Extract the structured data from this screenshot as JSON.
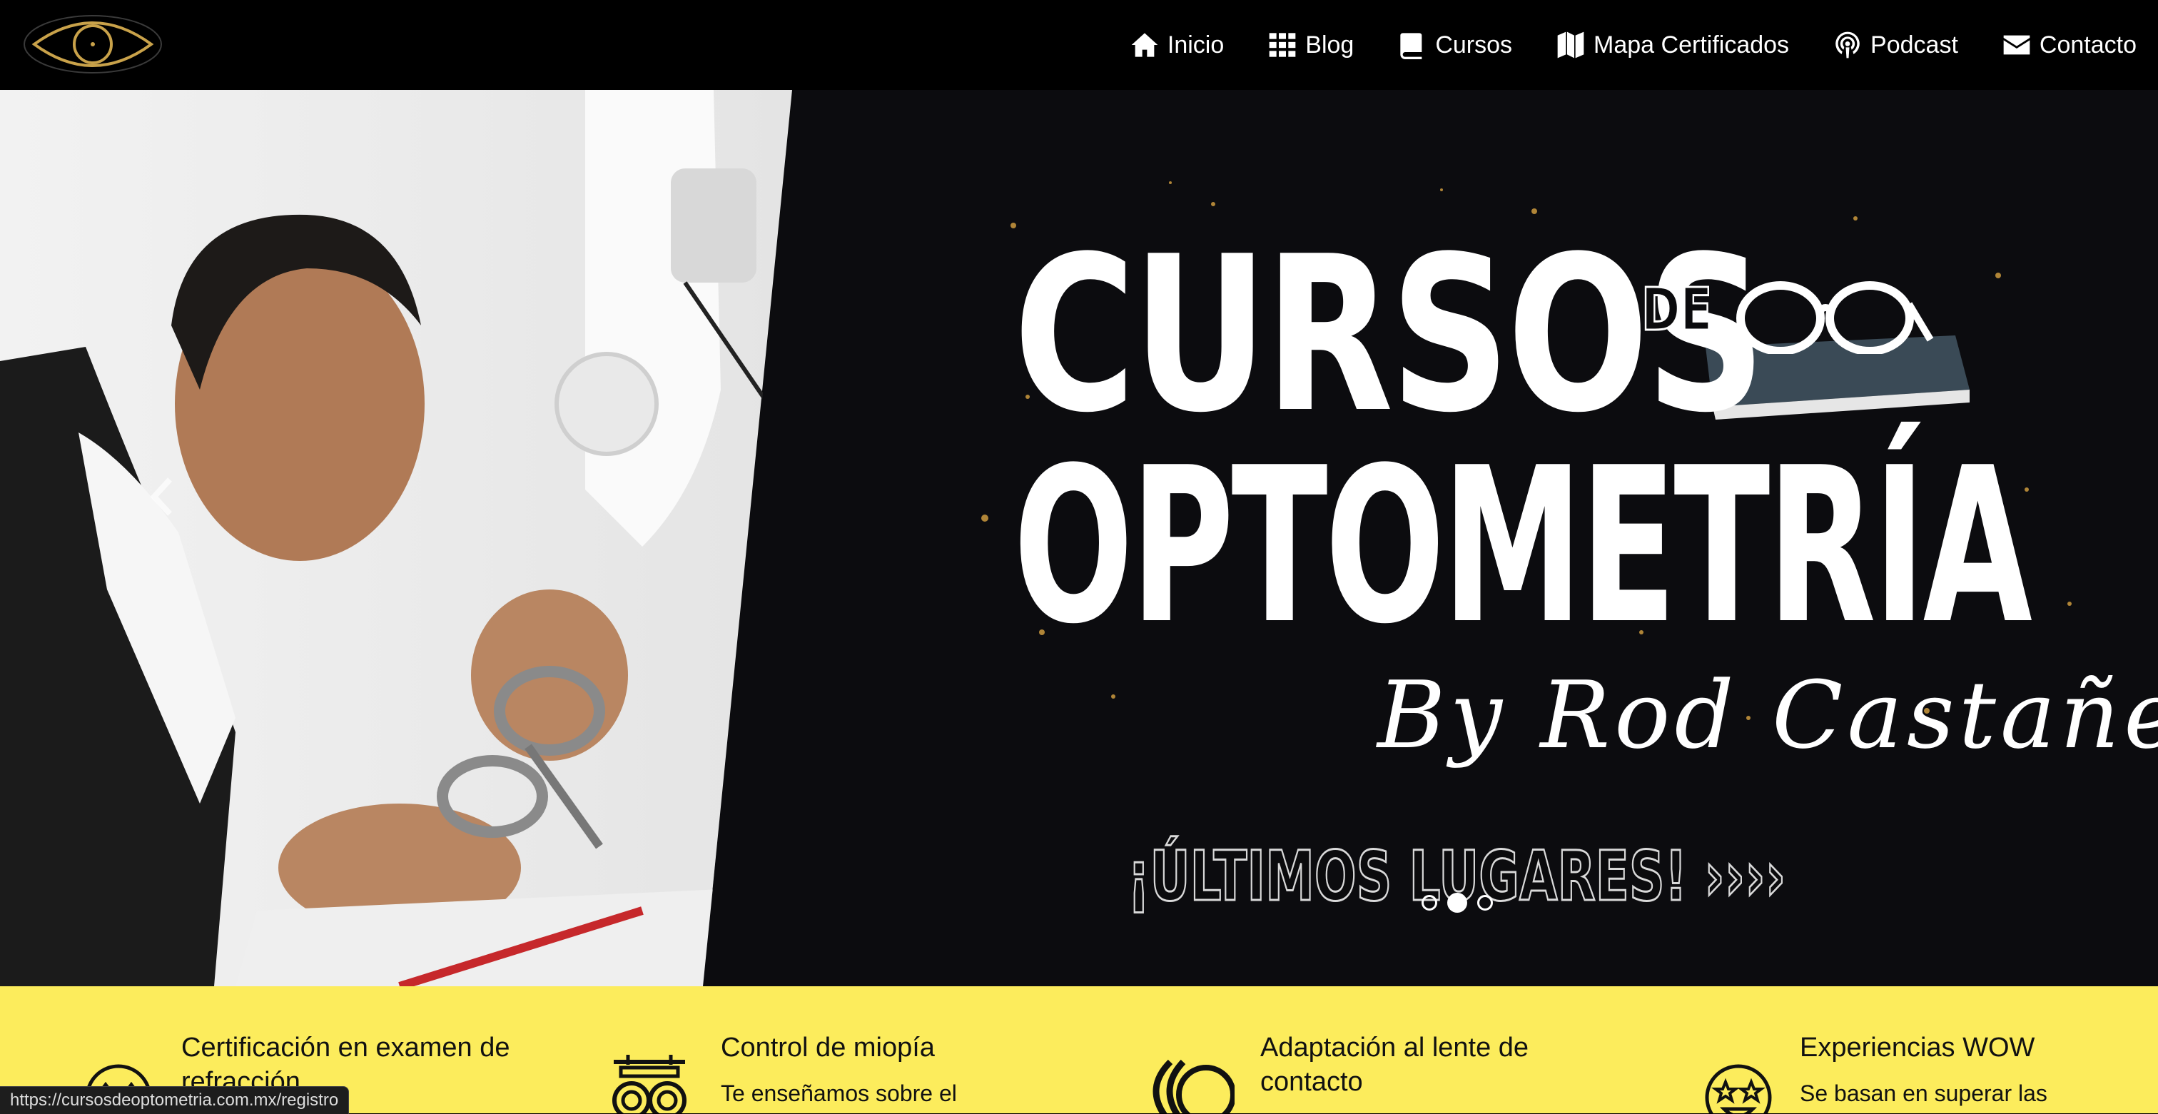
{
  "header": {
    "logo_icon": "eye-logo-icon",
    "nav": [
      {
        "label": "Inicio",
        "icon": "home-icon"
      },
      {
        "label": "Blog",
        "icon": "grid-icon"
      },
      {
        "label": "Cursos",
        "icon": "book-icon"
      },
      {
        "label": "Mapa Certificados",
        "icon": "map-icon"
      },
      {
        "label": "Podcast",
        "icon": "podcast-icon"
      },
      {
        "label": "Contacto",
        "icon": "envelope-icon"
      }
    ]
  },
  "hero": {
    "title_line1": "CURSOS",
    "title_de": "DE",
    "title_line2": "OPTOMETRÍA",
    "byline": "By Rod Castañeda",
    "cta": "¡ÚLTIMOS LUGARES! ››››",
    "slides_total": 3,
    "active_slide": 2
  },
  "features": [
    {
      "title": "Certificación en examen de refracción",
      "desc": "",
      "icon": "eye-exam-icon"
    },
    {
      "title": "Control de miopía",
      "desc": "Te enseñamos sobre el",
      "icon": "trial-frame-icon"
    },
    {
      "title": "Adaptación al lente de contacto",
      "desc": "",
      "icon": "contact-lens-icon"
    },
    {
      "title": "Experiencias WOW",
      "desc": "Se basan en superar las",
      "icon": "star-eyes-face-icon"
    }
  ],
  "status_bar": {
    "url": "https://cursosdeoptometria.com.mx/registro"
  },
  "colors": {
    "nav_bg": "#000000",
    "features_bg": "#fcec5c",
    "hero_bg": "#0b0b0d",
    "text_white": "#ffffff"
  }
}
